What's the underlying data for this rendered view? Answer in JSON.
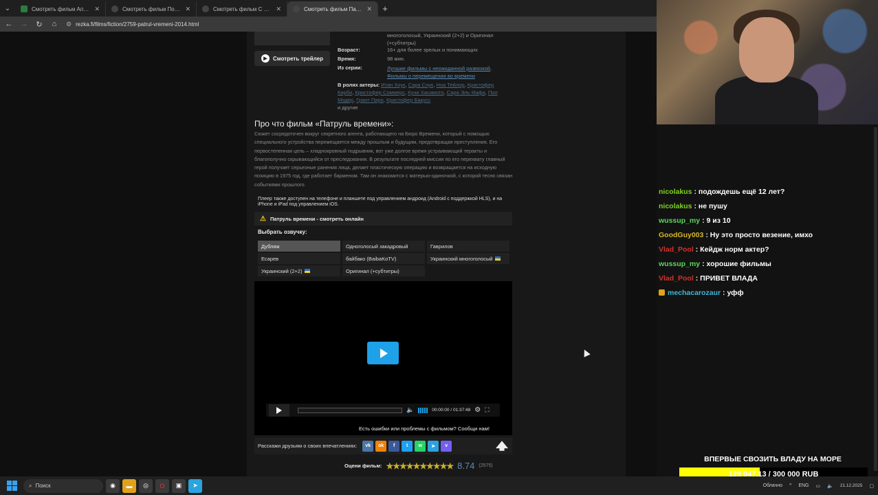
{
  "browser": {
    "tabs": [
      {
        "title": "Смотреть фильм Апокалипсис",
        "active": false
      },
      {
        "title": "Смотреть фильм Последний к",
        "active": false
      },
      {
        "title": "Смотреть фильм С широко за",
        "active": false
      },
      {
        "title": "Смотреть фильм Патруль врем",
        "active": true
      }
    ],
    "new_tab_label": "+",
    "url": "rezka.fi/films/fiction/2759-patrul-vremeni-2014.html"
  },
  "film": {
    "languages_fragment": "многоголосый, Украинский (2+2) и Оригинал (+субтитры)",
    "trailer_label": "Смотреть трейлер",
    "age_label": "Возраст:",
    "age_value": "16+ для более зрелых и понимающих",
    "time_label": "Время:",
    "time_value": "98 мин.",
    "series_label": "Из серии:",
    "series_links": [
      "Лучшие фильмы с неожиданной развязкой",
      "Фильмы о перемещении во времени"
    ],
    "actors_label": "В ролях актеры:",
    "actors": [
      "Итан Хоук",
      "Сара Снук",
      "Ноа Тейлор",
      "Кристофер Кирби",
      "Кристофер Соммерс",
      "Куни Хасимото",
      "Сара Эль-Яафи",
      "Пол Модер",
      "Грант Пиро",
      "Кристофер Бакусс"
    ],
    "actors_more": "и другие",
    "about_title": "Про что фильм «Патруль времени»:",
    "about_text": "Сюжет сосредоточен вокруг секретного агента, работающего на Бюро Времени, который с помощью специального устройства перемещается между прошлым и будущим, предотвращая преступления. Его первостепенная цель – хладнокровный подрывник, вот уже долгое время устраивающий теракты и благополучно скрывающийся от преследования. В результате последней миссии по его перехвату главный герой получает серьезные ранения лица, делает пластическую операцию и возвращается на исходную позицию в 1975 год, где работает барменом. Там он знакомится с матерью-одиночкой, с которой тесно связан событиями прошлого.",
    "player_note": "Плеер также доступен на телефоне и планшете под управлением андроид (Android с поддержкой HLS), и на iPhone и iPad под управлением iOS.",
    "watch_online_title": "Патруль времени - смотреть онлайн",
    "dub_label": "Выбрать озвучку:",
    "dubs": [
      {
        "name": "Дубляж",
        "active": true,
        "flag": false
      },
      {
        "name": "Одноголосый закадровый",
        "active": false,
        "flag": false
      },
      {
        "name": "Гаврилов",
        "active": false,
        "flag": false
      },
      {
        "name": "Есарев",
        "active": false,
        "flag": false
      },
      {
        "name": "байбако (BaibaKoTV)",
        "active": false,
        "flag": false
      },
      {
        "name": "Украинский многоголосый",
        "active": false,
        "flag": true
      },
      {
        "name": "Украинский (2+2)",
        "active": false,
        "flag": true
      },
      {
        "name": "Оригинал (+субтитры)",
        "active": false,
        "flag": false
      }
    ],
    "player": {
      "time_display": "00:00:00 / 01:37:48",
      "progress_fraction": 0
    },
    "errors_text": "Есть ошибки или проблемы с фильмом? Сообщи нам!",
    "share_label": "Расскажи друзьям о своих впечатлениях:",
    "social": [
      {
        "icon": "vk-icon",
        "glyph": "vk",
        "color": "#4a76a8"
      },
      {
        "icon": "ok-icon",
        "glyph": "ok",
        "color": "#ee8208"
      },
      {
        "icon": "facebook-icon",
        "glyph": "f",
        "color": "#3b5998"
      },
      {
        "icon": "twitter-icon",
        "glyph": "t",
        "color": "#1da1f2"
      },
      {
        "icon": "whatsapp-icon",
        "glyph": "w",
        "color": "#25d366"
      },
      {
        "icon": "telegram-icon",
        "glyph": "➤",
        "color": "#2aa3de"
      },
      {
        "icon": "viber-icon",
        "glyph": "v",
        "color": "#7360f2"
      }
    ],
    "rating_label": "Оцени фильм:",
    "rating_score": "8.74",
    "rating_votes": "(2575)",
    "rating_stars_filled": 10
  },
  "chat": [
    {
      "user": "nicolakus",
      "color": "#7ed321",
      "text": ": подождешь ещё 12 лет?",
      "badge": false
    },
    {
      "user": "nicolakus",
      "color": "#7ed321",
      "text": ": не пушу",
      "badge": false
    },
    {
      "user": "wussup_my",
      "color": "#5cd65c",
      "text": ": 9 из 10",
      "badge": false
    },
    {
      "user": "GoodGuy003",
      "color": "#d4b82a",
      "text": ": Ну это просто везение, имхо",
      "badge": false
    },
    {
      "user": "Vlad_Pool",
      "color": "#d0342c",
      "text": ": Кейдж норм актер?",
      "badge": false
    },
    {
      "user": "wussup_my",
      "color": "#5cd65c",
      "text": ": хорошие фильмы",
      "badge": false
    },
    {
      "user": "Vlad_Pool",
      "color": "#d0342c",
      "text": ": ПРИВЕТ ВЛАДА",
      "badge": false
    },
    {
      "user": "mechacarozaur",
      "color": "#3fb8d6",
      "text": ": уфф",
      "badge": true
    }
  ],
  "goal": {
    "title": "ВПЕРВЫЕ СВОЗИТЬ ВЛАДУ НА МОРЕ",
    "progress_text": "128 047.13 / 300 000 RUB",
    "fraction": 0.427
  },
  "taskbar": {
    "search_placeholder": "Поиск",
    "weather": "Облачно",
    "lang": "ENG",
    "date": "21.12.2025"
  }
}
